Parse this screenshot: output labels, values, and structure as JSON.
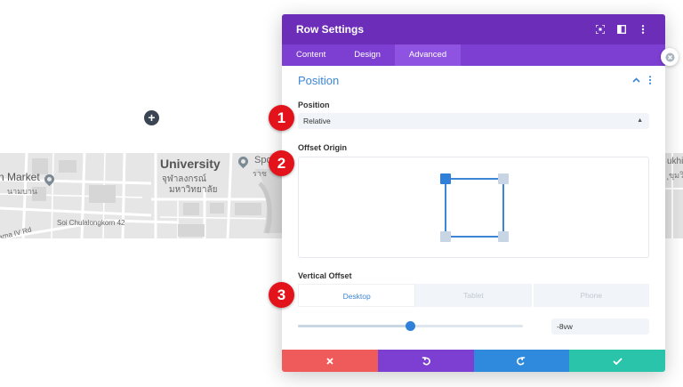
{
  "modal": {
    "title": "Row Settings",
    "tabs": [
      {
        "label": "Content",
        "active": false
      },
      {
        "label": "Design",
        "active": false
      },
      {
        "label": "Advanced",
        "active": true
      }
    ]
  },
  "section": {
    "title": "Position"
  },
  "position_field": {
    "label": "Position",
    "value": "Relative"
  },
  "offset_origin": {
    "label": "Offset Origin",
    "selected": "top-left"
  },
  "vertical_offset": {
    "label": "Vertical Offset",
    "devices": [
      {
        "label": "Desktop",
        "active": true
      },
      {
        "label": "Tablet",
        "active": false
      },
      {
        "label": "Phone",
        "active": false
      }
    ],
    "value": "-8vw",
    "slider_fraction": 0.5
  },
  "steps": [
    "1",
    "2",
    "3"
  ],
  "map": {
    "labels": {
      "university": "University",
      "thai_line1": "จุฬาลงกรณ์",
      "thai_line2": "มหาวิทยาลัย",
      "market": "n Market",
      "market_thai": "นามบาน",
      "soi": "Soi Chulalongkorn 42",
      "rama_iv": "ama IV Rd",
      "sports": "Spo",
      "sports_thai": "ราช",
      "right_edge": "ukhi",
      "right_edge2": "ุขุมวิ"
    }
  },
  "colors": {
    "header": "#6c2eb9",
    "tabs": "#7d3fd2",
    "accent_blue": "#3d86d6",
    "cancel": "#ef5b5b",
    "undo": "#7d3fd2",
    "redo": "#2f89dc",
    "save": "#29c4a9",
    "step_badge": "#e3131b"
  },
  "icons": {
    "header": [
      "fullscreen-icon",
      "split-view-icon",
      "more-vertical-icon"
    ],
    "section": [
      "chevron-up-icon",
      "more-vertical-icon"
    ],
    "footer": [
      "close-icon",
      "undo-icon",
      "redo-icon",
      "check-icon"
    ]
  }
}
